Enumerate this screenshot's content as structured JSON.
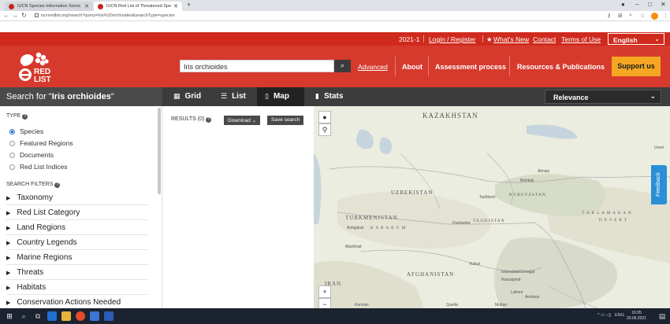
{
  "browser": {
    "tabs": [
      {
        "title": "IUCN Species Information Servic"
      },
      {
        "title": "IUCN Red List of Threatened Spe"
      }
    ],
    "new_tab": "+",
    "url": "iucnredlist.org/search?query=Iris%20orchioides&searchType=species",
    "window_controls": [
      "–",
      "□",
      "✕"
    ]
  },
  "site": {
    "top_links": {
      "version": "2021-1",
      "login": "Login / Register",
      "whats_new": "What's New",
      "contact": "Contact",
      "terms": "Terms of Use",
      "language": "English"
    },
    "logo": {
      "text_line1": "RED",
      "text_line2": "LIST"
    },
    "search": {
      "value": "Iris orchioides",
      "advanced": "Advanced"
    },
    "menu": [
      "About",
      "Assessment process",
      "Resources & Publications"
    ],
    "support": "Support us",
    "colors": {
      "brand_red": "#d63a2d",
      "strip_red": "#cf2a1d",
      "support_orange": "#f5a623",
      "dark_bar": "#3c3c3c"
    }
  },
  "searchbar": {
    "prefix": "Search for \"",
    "query": "Iris orchioides",
    "suffix": "\"",
    "views": [
      {
        "label": "Grid",
        "icon": "grid-icon"
      },
      {
        "label": "List",
        "icon": "list-icon"
      },
      {
        "label": "Map",
        "icon": "map-icon",
        "active": true
      },
      {
        "label": "Stats",
        "icon": "stats-icon"
      }
    ],
    "sort": "Relevance"
  },
  "sidebar": {
    "type_title": "TYPE",
    "types": [
      {
        "label": "Species",
        "checked": true
      },
      {
        "label": "Featured Regions",
        "checked": false
      },
      {
        "label": "Documents",
        "checked": false
      },
      {
        "label": "Red List Indices",
        "checked": false
      }
    ],
    "filters_title": "SEARCH FILTERS",
    "filters": [
      "Taxonomy",
      "Red List Category",
      "Land Regions",
      "Country Legends",
      "Marine Regions",
      "Threats",
      "Habitats",
      "Conservation Actions Needed"
    ]
  },
  "results": {
    "label": "RESULTS (0)",
    "download": "Download",
    "save": "Save search"
  },
  "map": {
    "labels": {
      "kazakhstan": "KAZAKHSTAN",
      "uzbekistan": "UZBEKISTAN",
      "turkmenistan": "TURKMENISTAN",
      "afghanistan": "AFGHANISTAN",
      "iran": "IRAN",
      "tajikistan": "TAJIKISTAN",
      "kyrgyzstan": "KYRGYZSTAN",
      "karakum": "K A R A K U M",
      "taklamakan": "T A K L A   M A K A N",
      "desert": "D E S E R T"
    },
    "cities": [
      "Almaty",
      "Bishkek",
      "Tashkent",
      "Dushanbe",
      "Ashgabat",
      "Mashhad",
      "Kabul",
      "Islamabad",
      "Srinagar",
      "Rawalpindi",
      "Lahore",
      "Amritsar",
      "Quetta",
      "Multan",
      "Kerman",
      "Urum"
    ],
    "zoom_in": "+",
    "zoom_out": "−"
  },
  "feedback": "Feedback",
  "taskbar": {
    "tray": "ENG",
    "time": "16:05",
    "date": "20.06.2021"
  }
}
